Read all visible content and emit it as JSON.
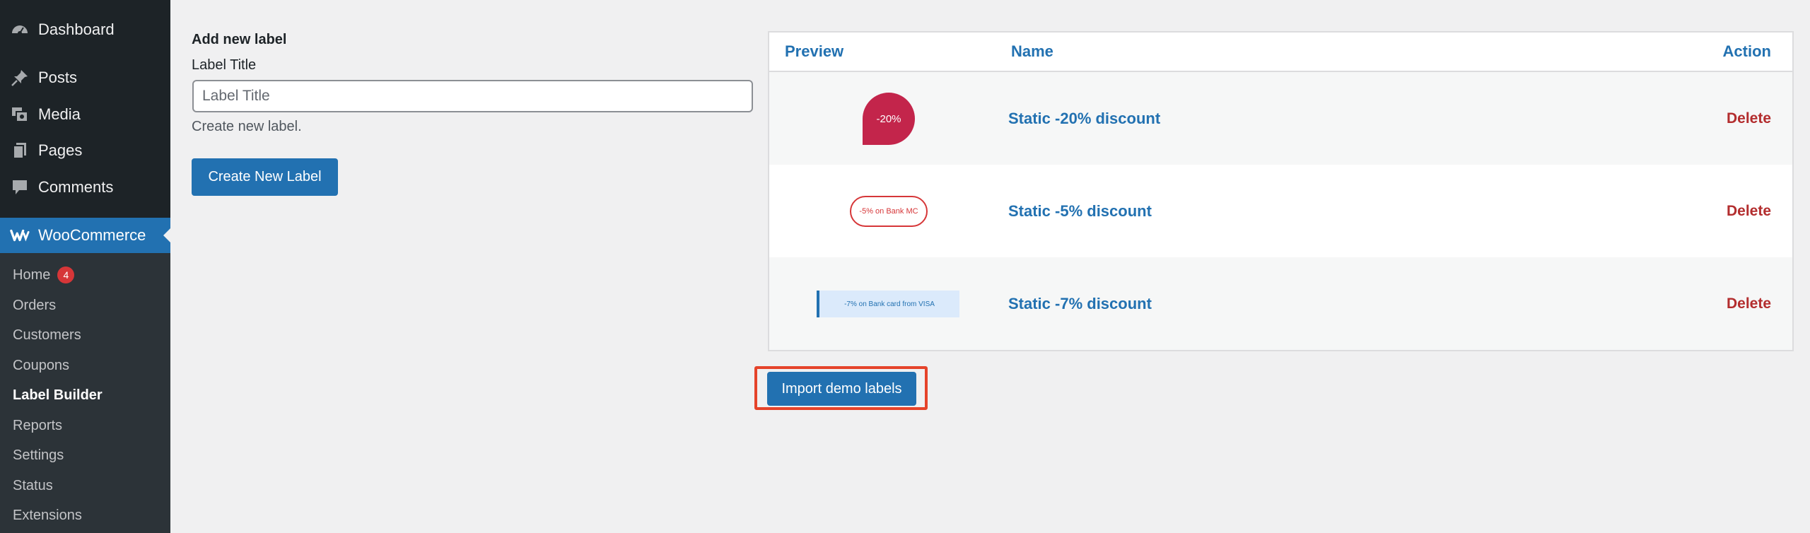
{
  "sidebar": {
    "menu": [
      {
        "label": "Dashboard",
        "icon": "dashboard-icon"
      },
      {
        "label": "Posts",
        "icon": "pin-icon"
      },
      {
        "label": "Media",
        "icon": "media-icon"
      },
      {
        "label": "Pages",
        "icon": "pages-icon"
      },
      {
        "label": "Comments",
        "icon": "comment-icon"
      }
    ],
    "woocommerce": {
      "label": "WooCommerce",
      "icon": "woocommerce-icon"
    },
    "submenu": {
      "home": {
        "label": "Home",
        "badge": "4"
      },
      "items": [
        "Orders",
        "Customers",
        "Coupons",
        "Label Builder",
        "Reports",
        "Settings",
        "Status",
        "Extensions"
      ],
      "current": "Label Builder"
    }
  },
  "form": {
    "title": "Add new label",
    "field_label": "Label Title",
    "placeholder": "Label Title",
    "value": "",
    "description": "Create new label.",
    "submit_label": "Create New Label"
  },
  "table": {
    "headers": {
      "preview": "Preview",
      "name": "Name",
      "action": "Action"
    },
    "rows": [
      {
        "preview_text": "-20%",
        "name": "Static -20% discount",
        "action": "Delete"
      },
      {
        "preview_text": "-5% on Bank MC",
        "name": "Static -5% discount",
        "action": "Delete"
      },
      {
        "preview_text": "-7% on Bank card from VISA",
        "name": "Static -7% discount",
        "action": "Delete"
      }
    ]
  },
  "import_button": {
    "label": "Import demo labels"
  },
  "colors": {
    "sidebar_bg": "#1d2327",
    "submenu_bg": "#2c3338",
    "accent": "#2271b1",
    "delete": "#b32d2e",
    "highlight": "#e5432a",
    "label_red": "#c3254b"
  }
}
